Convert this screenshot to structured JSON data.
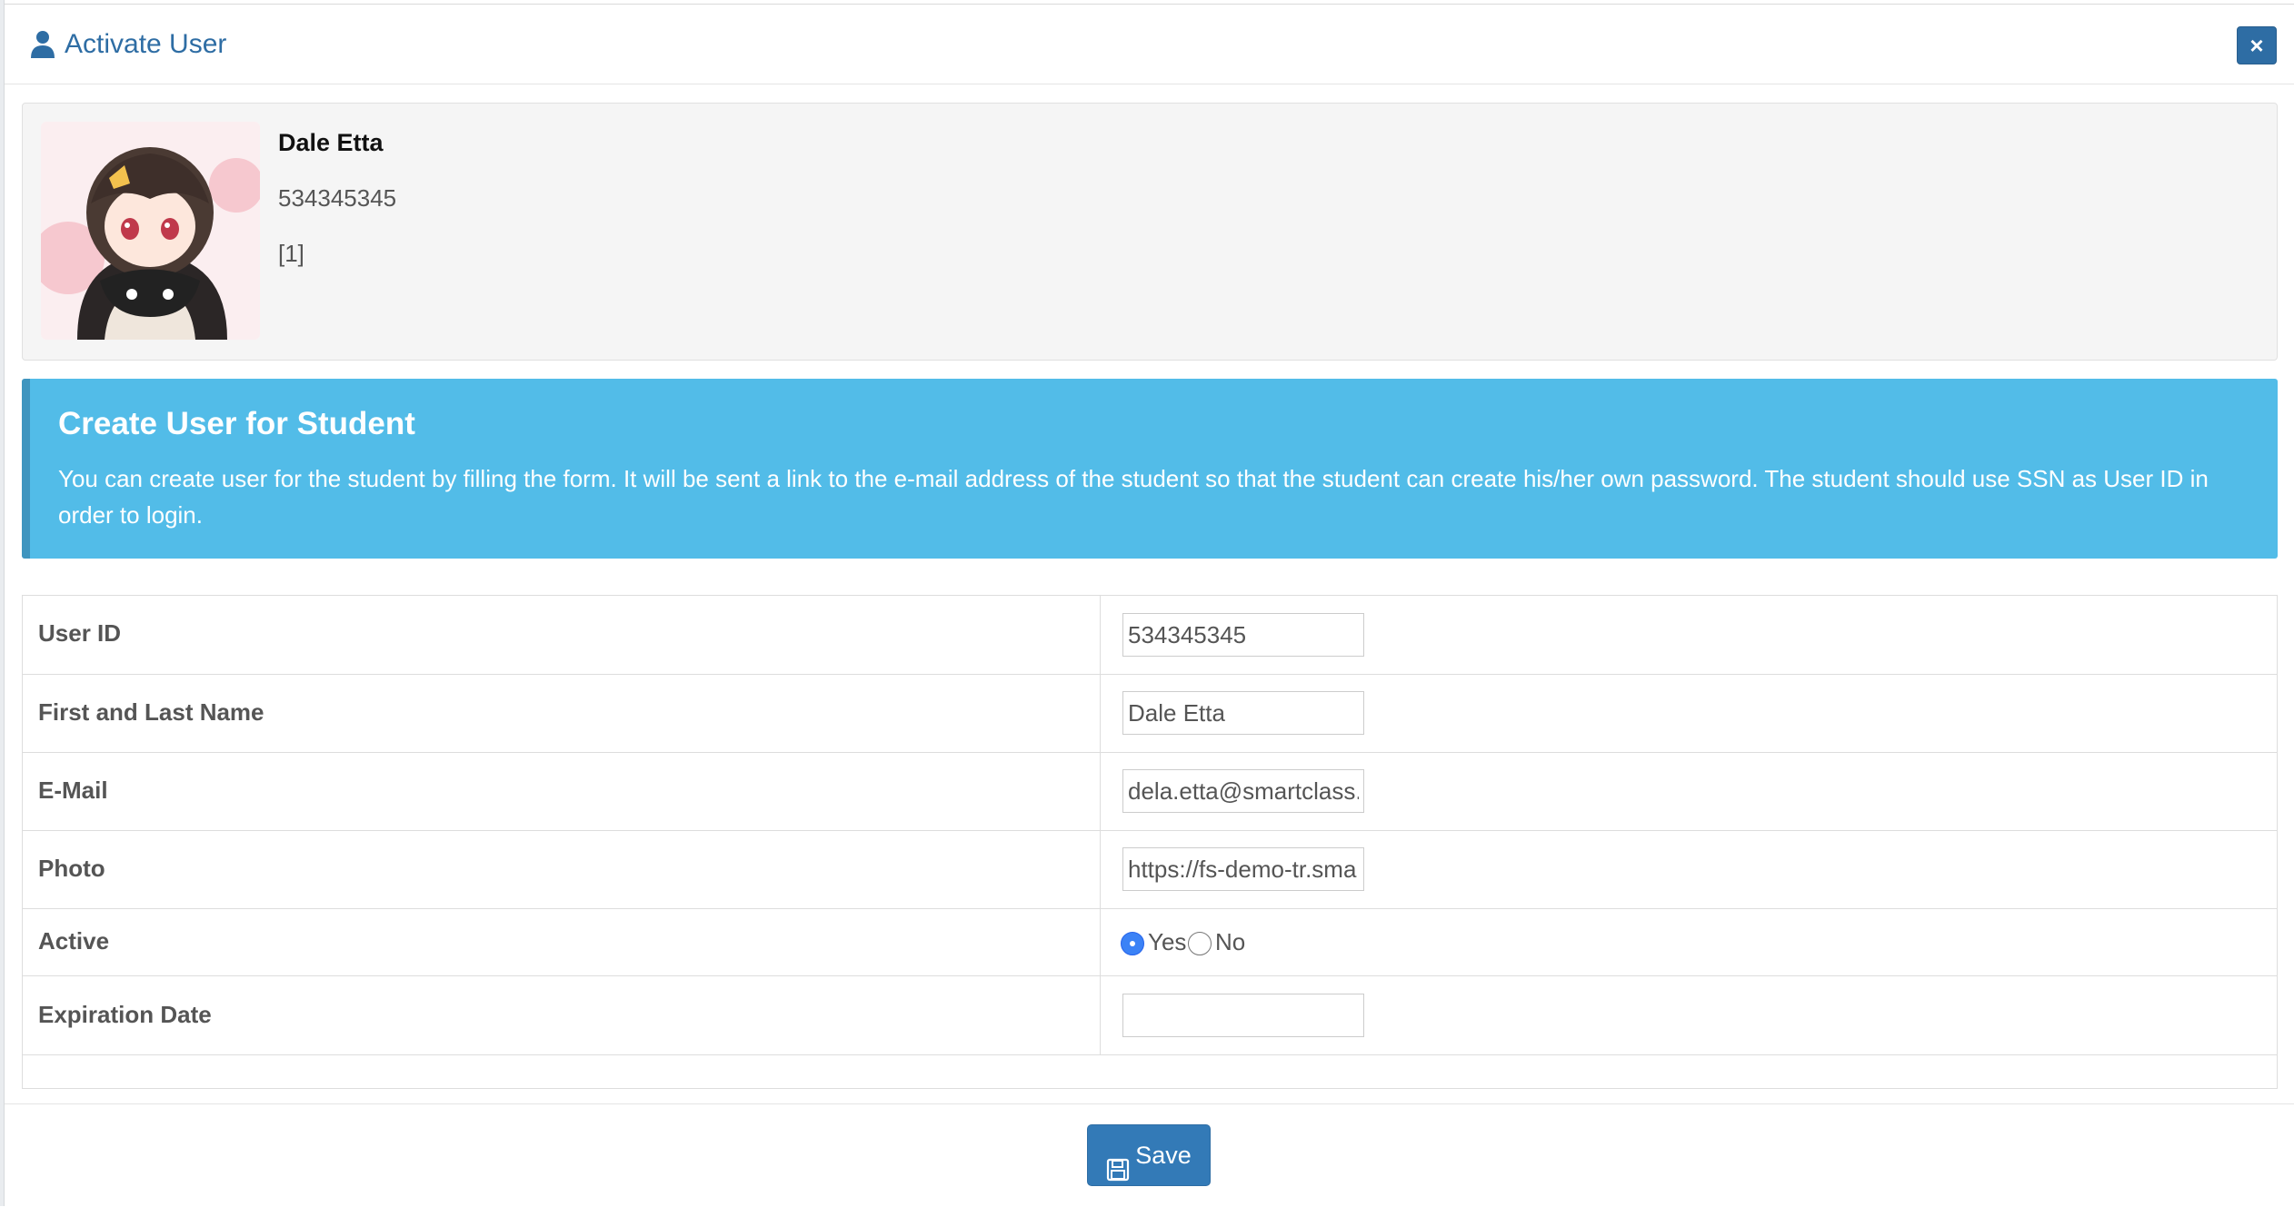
{
  "header": {
    "title": "Activate User",
    "icon": "user-icon",
    "close_icon": "close-icon",
    "close_glyph": "×"
  },
  "profile": {
    "name": "Dale Etta",
    "ssn": "534345345",
    "tag": "[1]"
  },
  "callout": {
    "title": "Create User for Student",
    "text": "You can create user for the student by filling the form. It will be sent a link to the e-mail address of the student so that the student can create his/her own password. The student should use SSN as User ID in order to login."
  },
  "form": {
    "user_id": {
      "label": "User ID",
      "value": "534345345"
    },
    "name": {
      "label": "First and Last Name",
      "value": "Dale Etta"
    },
    "email": {
      "label": "E-Mail",
      "value": "dela.etta@smartclass."
    },
    "photo": {
      "label": "Photo",
      "value": "https://fs-demo-tr.sma"
    },
    "active": {
      "label": "Active",
      "yes": "Yes",
      "no": "No",
      "selected": "Yes"
    },
    "expiration": {
      "label": "Expiration Date",
      "value": ""
    }
  },
  "footer": {
    "save_label": "Save",
    "save_icon": "floppy-disk-icon"
  },
  "colors": {
    "accent": "#337ab7",
    "callout": "#52bce8",
    "title": "#2e6da4"
  }
}
